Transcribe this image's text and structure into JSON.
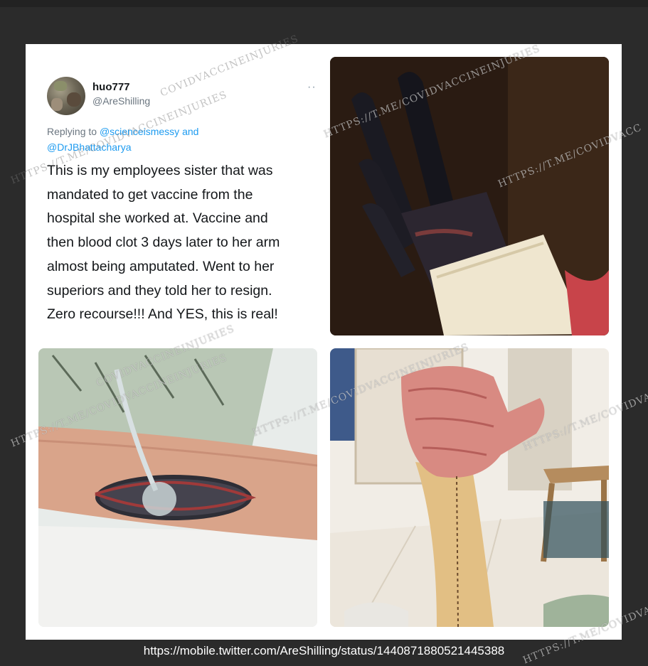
{
  "tweet": {
    "display_name": "huo777",
    "handle": "@AreShilling",
    "more_icon": "ellipsis-icon",
    "reply_prefix": "Replying to",
    "reply_mention_1": "@scienceismessy",
    "reply_and": "and",
    "reply_mention_2": "@DrJBhattacharya",
    "body_lines": [
      "This is my employees sister that was",
      "mandated to get vaccine from the",
      "hospital she worked at. Vaccine and",
      "then blood clot 3 days later to her arm",
      "almost being amputated. Went to her",
      "superiors and they told her to resign.",
      "Zero recourse!!! And YES, this is real!"
    ]
  },
  "watermarks": {
    "tag_a": "COVIDVACCINEINJURIES",
    "tag_b": "HTTPS://T.ME/COVIDVACCINEINJURIES",
    "tag_c": "HTTPS://T.ME/COVIDVACC",
    "tag_d": "HTTPS://T.ME/COVIDVACCINEINJURIES",
    "tag_e": "COVIDVACCINEINJURIES",
    "tag_f": "HTTPS://T.ME/COVIDVACCINEINJURIES",
    "tag_g": "HTTPS://T.ME/COVIDVACCINEINJURIES",
    "tag_h": "HTTPS://T.ME/COVIDVACC",
    "tag_i": "HTTPS://T.ME/COVIDVACC"
  },
  "caption": {
    "url": "https://mobile.twitter.com/AreShilling/status/1440871880521445388"
  },
  "colors": {
    "background": "#2b2b2b",
    "card": "#ffffff",
    "link": "#1d9bf0",
    "text": "#14171a",
    "muted": "#6b7680"
  }
}
